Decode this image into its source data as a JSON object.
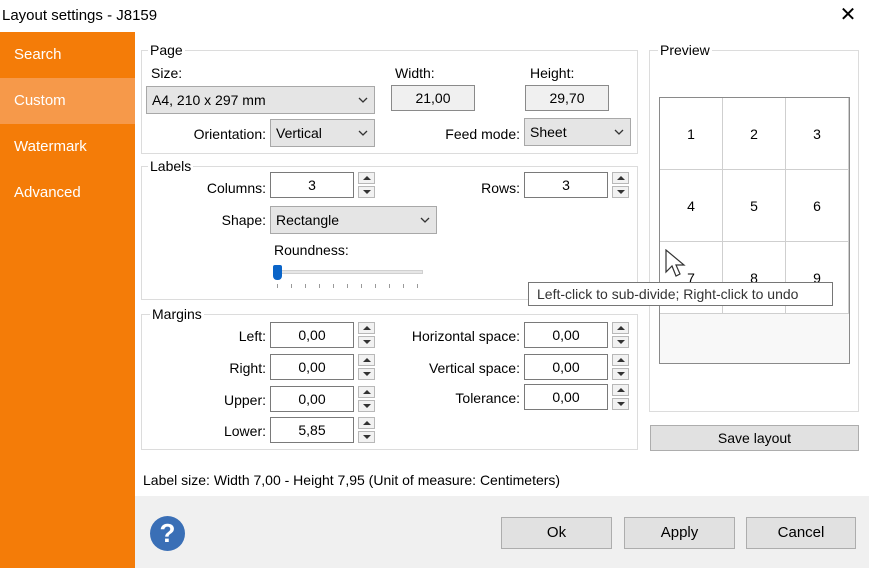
{
  "window": {
    "title": "Layout settings - J8159",
    "close_glyph": "✕"
  },
  "sidebar": {
    "items": [
      {
        "label": "Search"
      },
      {
        "label": "Custom",
        "active": true
      },
      {
        "label": "Watermark"
      },
      {
        "label": "Advanced"
      }
    ]
  },
  "page": {
    "legend": "Page",
    "size_label": "Size:",
    "size_value": "A4, 210 x 297 mm",
    "width_label": "Width:",
    "width_value": "21,00",
    "height_label": "Height:",
    "height_value": "29,70",
    "orientation_label": "Orientation:",
    "orientation_value": "Vertical",
    "feed_label": "Feed mode:",
    "feed_value": "Sheet"
  },
  "labels": {
    "legend": "Labels",
    "columns_label": "Columns:",
    "columns_value": "3",
    "rows_label": "Rows:",
    "rows_value": "3",
    "shape_label": "Shape:",
    "shape_value": "Rectangle",
    "roundness_label": "Roundness:",
    "roundness_level": 0
  },
  "margins": {
    "legend": "Margins",
    "left_label": "Left:",
    "left_value": "0,00",
    "right_label": "Right:",
    "right_value": "0,00",
    "upper_label": "Upper:",
    "upper_value": "0,00",
    "lower_label": "Lower:",
    "lower_value": "5,85",
    "hspace_label": "Horizontal space:",
    "hspace_value": "0,00",
    "vspace_label": "Vertical space:",
    "vspace_value": "0,00",
    "tolerance_label": "Tolerance:",
    "tolerance_value": "0,00"
  },
  "preview": {
    "legend": "Preview",
    "cells": [
      "1",
      "2",
      "3",
      "4",
      "5",
      "6",
      "7",
      "8",
      "9"
    ],
    "tooltip": "Left-click to sub-divide; Right-click to undo",
    "save_label": "Save layout"
  },
  "status": "Label size: Width 7,00 - Height 7,95 (Unit of measure: Centimeters)",
  "footer": {
    "help_glyph": "?",
    "ok_label": "Ok",
    "apply_label": "Apply",
    "cancel_label": "Cancel"
  },
  "colors": {
    "sidebar": "#f47c08",
    "sidebar_active": "#f6994a",
    "accent": "#0a64c8",
    "help": "#3a6fb6"
  }
}
